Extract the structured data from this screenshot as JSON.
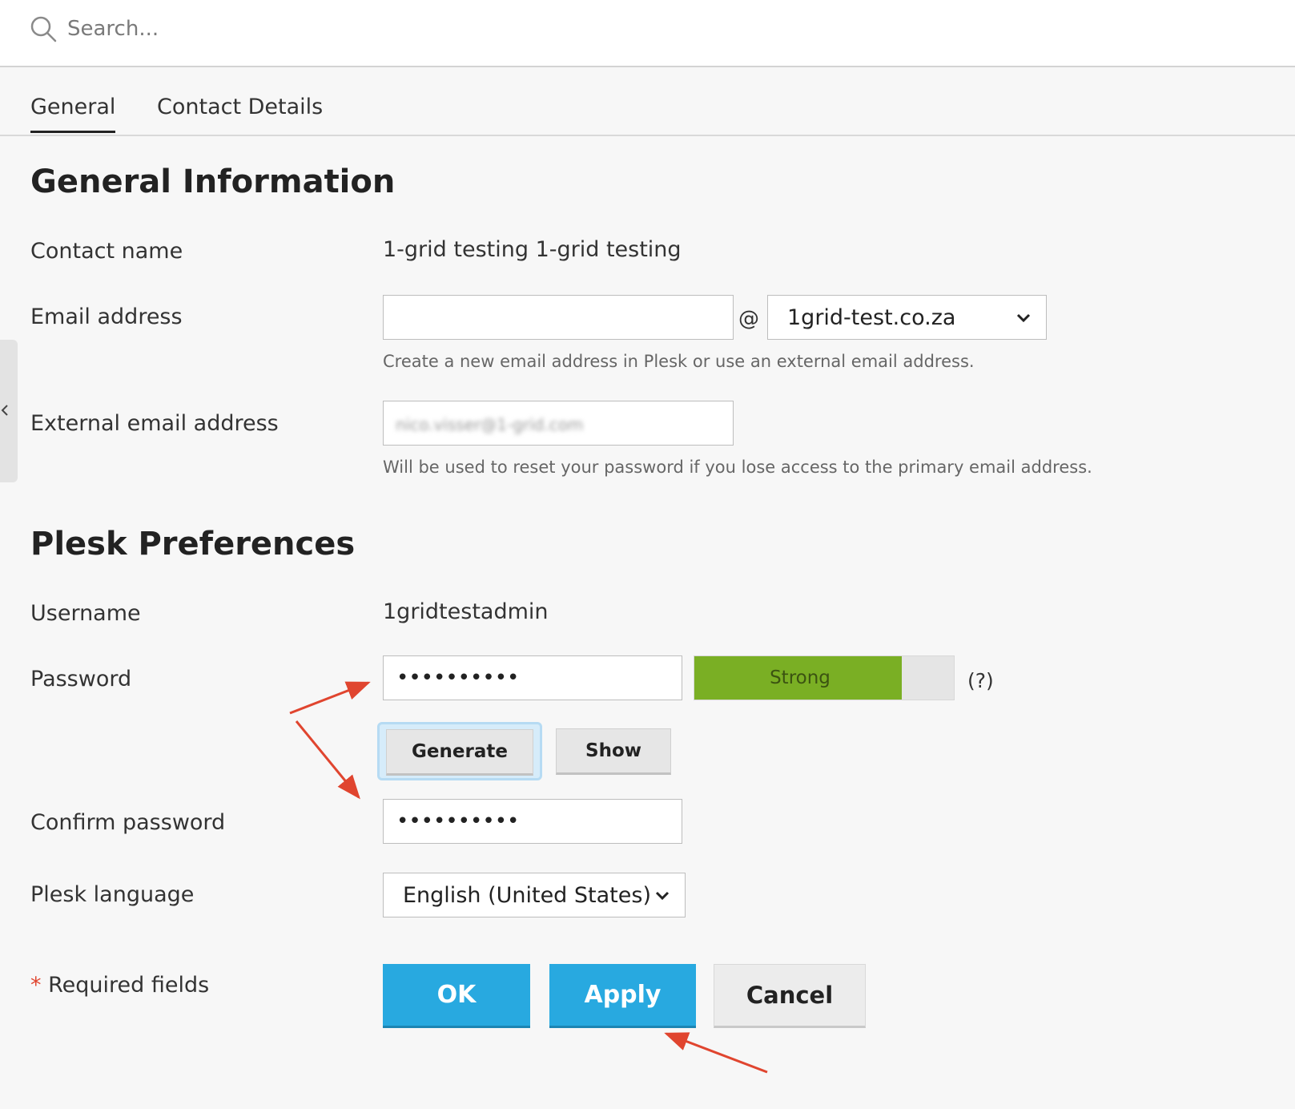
{
  "search": {
    "placeholder": "Search..."
  },
  "tabs": [
    {
      "label": "General",
      "active": true
    },
    {
      "label": "Contact Details",
      "active": false
    }
  ],
  "general_info": {
    "title": "General Information",
    "contact_name_label": "Contact name",
    "contact_name_value": "1-grid testing 1-grid testing",
    "email_label": "Email address",
    "email_value": "",
    "at_sign": "@",
    "email_domain": "1grid-test.co.za",
    "email_hint": "Create a new email address in Plesk or use an external email address.",
    "external_email_label": "External email address",
    "external_email_value": "nico.visser@1-grid.com",
    "external_email_hint": "Will be used to reset your password if you lose access to the primary email address."
  },
  "preferences": {
    "title": "Plesk Preferences",
    "username_label": "Username",
    "username_value": "1gridtestadmin",
    "password_label": "Password",
    "password_value": "••••••••••",
    "strength_label": "Strong",
    "strength_level": 0.8,
    "strength_color": "#7aaf24",
    "help_label": "(?)",
    "generate_label": "Generate",
    "show_label": "Show",
    "confirm_label": "Confirm password",
    "confirm_value": "••••••••••",
    "language_label": "Plesk language",
    "language_value": "English (United States)"
  },
  "footer": {
    "required_star": "*",
    "required_text": "Required fields",
    "ok_label": "OK",
    "apply_label": "Apply",
    "cancel_label": "Cancel"
  },
  "colors": {
    "primary": "#28a9e0",
    "annotation_arrow": "#e0452f"
  }
}
